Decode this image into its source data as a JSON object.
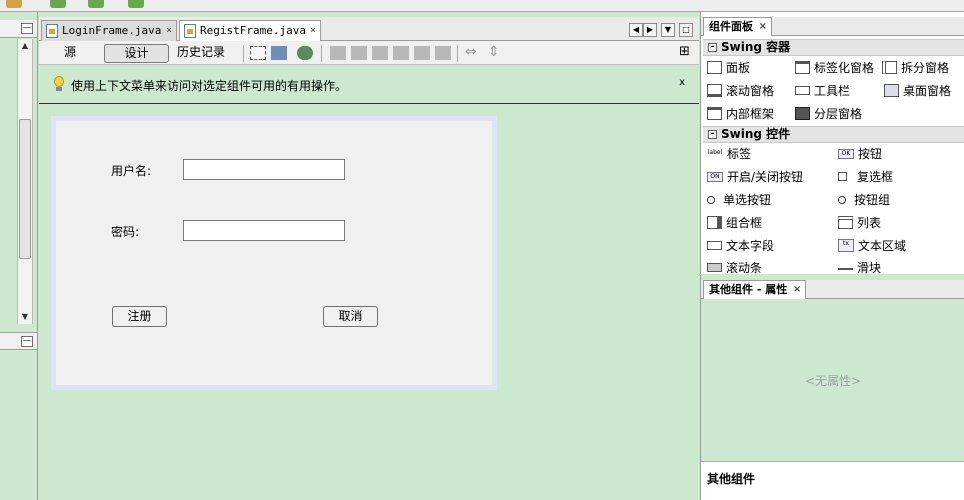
{
  "editor": {
    "tabs": [
      {
        "label": "LoginFrame.java",
        "close": "×"
      },
      {
        "label": "RegistFrame.java",
        "close": "×"
      }
    ],
    "modes": {
      "source": "源",
      "design": "设计",
      "history": "历史记录"
    },
    "hint": "使用上下文菜单来访问对选定组件可用的有用操作。",
    "hint_close": "x"
  },
  "form": {
    "username_label": "用户名:",
    "username_value": "",
    "password_label": "密码:",
    "password_value": "",
    "register_button": "注册",
    "cancel_button": "取消"
  },
  "palette": {
    "title": "组件面板",
    "close": "×",
    "containers_header": "Swing 容器",
    "containers": [
      "面板",
      "标签化窗格",
      "拆分窗格",
      "滚动窗格",
      "工具栏",
      "桌面窗格",
      "内部框架",
      "分层窗格"
    ],
    "controls_header": "Swing 控件",
    "controls": [
      "标签",
      "按钮",
      "开启/关闭按钮",
      "复选框",
      "单选按钮",
      "按钮组",
      "组合框",
      "列表",
      "文本字段",
      "文本区域",
      "滚动条",
      "滑块"
    ]
  },
  "properties": {
    "title": "其他组件 - 属性",
    "close": "×",
    "empty_text": "<无属性>",
    "footer": "其他组件"
  },
  "icons": {
    "label_icon_text": "label",
    "button_icon_text": "OK",
    "toggle_icon_text": "ON",
    "textarea_icon_text": "tx"
  }
}
